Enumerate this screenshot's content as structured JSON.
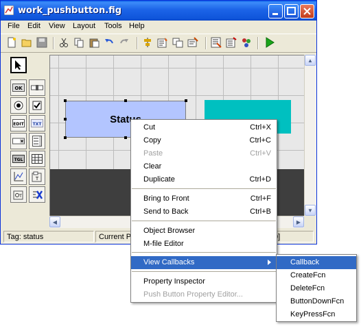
{
  "window": {
    "title": "work_pushbutton.fig",
    "menu": [
      "File",
      "Edit",
      "View",
      "Layout",
      "Tools",
      "Help"
    ]
  },
  "toolbar": {
    "icons": [
      "new-icon",
      "open-icon",
      "save-icon",
      "cut-icon",
      "copy-icon",
      "paste-icon",
      "undo-icon",
      "redo-icon",
      "align-icon",
      "menu-editor-icon",
      "tab-order-icon",
      "toolbar-editor-icon",
      "mfile-editor-icon",
      "property-inspector-icon",
      "object-browser-icon",
      "run-icon"
    ]
  },
  "palette": {
    "items": [
      {
        "name": "select-tool",
        "label": ""
      },
      {
        "name": "push-button-tool",
        "label": "OK"
      },
      {
        "name": "slider-tool",
        "label": ""
      },
      {
        "name": "radio-button-tool",
        "label": ""
      },
      {
        "name": "checkbox-tool",
        "label": ""
      },
      {
        "name": "edit-text-tool",
        "label": "EDIT"
      },
      {
        "name": "static-text-tool",
        "label": "TXT"
      },
      {
        "name": "popup-menu-tool",
        "label": ""
      },
      {
        "name": "listbox-tool",
        "label": ""
      },
      {
        "name": "toggle-button-tool",
        "label": "TGL"
      },
      {
        "name": "table-tool",
        "label": ""
      },
      {
        "name": "axes-tool",
        "label": ""
      },
      {
        "name": "panel-tool",
        "label": ""
      },
      {
        "name": "button-group-tool",
        "label": ""
      },
      {
        "name": "activex-tool",
        "label": ""
      }
    ]
  },
  "canvas": {
    "status_button_label": "Status"
  },
  "statusbar": {
    "tag": "Tag: status",
    "current_point": "Current P",
    "position_tail": "0]"
  },
  "context_menu": {
    "items": [
      {
        "label": "Cut",
        "shortcut": "Ctrl+X",
        "disabled": false
      },
      {
        "label": "Copy",
        "shortcut": "Ctrl+C",
        "disabled": false
      },
      {
        "label": "Paste",
        "shortcut": "Ctrl+V",
        "disabled": true
      },
      {
        "label": "Clear",
        "shortcut": "",
        "disabled": false
      },
      {
        "label": "Duplicate",
        "shortcut": "Ctrl+D",
        "disabled": false
      },
      {
        "label": "Bring to Front",
        "shortcut": "Ctrl+F",
        "disabled": false
      },
      {
        "label": "Send to Back",
        "shortcut": "Ctrl+B",
        "disabled": false
      },
      {
        "label": "Object Browser",
        "shortcut": "",
        "disabled": false
      },
      {
        "label": "M-file Editor",
        "shortcut": "",
        "disabled": false
      },
      {
        "label": "View Callbacks",
        "shortcut": "",
        "disabled": false,
        "highlighted": true
      },
      {
        "label": "Property Inspector",
        "shortcut": "",
        "disabled": false
      },
      {
        "label": "Push Button Property Editor...",
        "shortcut": "",
        "disabled": true
      }
    ]
  },
  "submenu": {
    "items": [
      "Callback",
      "CreateFcn",
      "DeleteFcn",
      "ButtonDownFcn",
      "KeyPressFcn"
    ],
    "highlighted": "Callback"
  },
  "colors": {
    "titlebar": "#0a5ce6",
    "status_button_fill": "#b3c5ff",
    "teal_block": "#00c0c0",
    "dark_band": "#3e3e3e",
    "highlight": "#316ac5"
  }
}
